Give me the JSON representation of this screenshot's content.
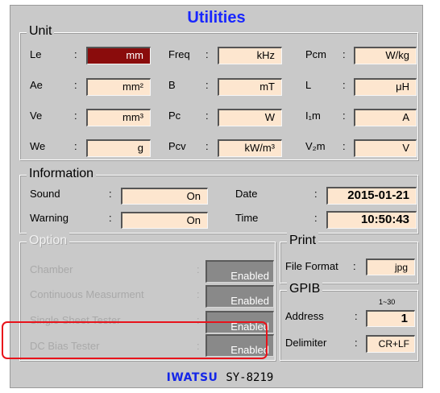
{
  "title": "Utilities",
  "unit": {
    "legend": "Unit",
    "fields": [
      {
        "label": "Le",
        "value": "mm",
        "selected": true
      },
      {
        "label": "Freq",
        "value": "kHz"
      },
      {
        "label": "Pcm",
        "value": "W/kg"
      },
      {
        "label": "Ae",
        "value": "mm²"
      },
      {
        "label": "B",
        "value": "mT"
      },
      {
        "label": "L",
        "value": "μH"
      },
      {
        "label": "Ve",
        "value": "mm³"
      },
      {
        "label": "Pc",
        "value": "W"
      },
      {
        "label": "I₁m",
        "value": "A"
      },
      {
        "label": "We",
        "value": "g"
      },
      {
        "label": "Pcv",
        "value": "kW/m³"
      },
      {
        "label": "V₂m",
        "value": "V"
      }
    ]
  },
  "information": {
    "legend": "Information",
    "sound": {
      "label": "Sound",
      "value": "On"
    },
    "warning": {
      "label": "Warning",
      "value": "On"
    },
    "date": {
      "label": "Date",
      "value": "2015-01-21"
    },
    "time": {
      "label": "Time",
      "value": "10:50:43"
    }
  },
  "option": {
    "legend": "Option",
    "items": [
      {
        "label": "Chamber",
        "value": "Enabled"
      },
      {
        "label": "Continuous Measurment",
        "value": "Enabled"
      },
      {
        "label": "Single Sheet Tester",
        "value": "Enabled"
      },
      {
        "label": "DC Bias Tester",
        "value": "Enabled"
      }
    ]
  },
  "print": {
    "legend": "Print",
    "file_format": {
      "label": "File Format",
      "value": "jpg"
    }
  },
  "gpib": {
    "legend": "GPIB",
    "range": "1~30",
    "address": {
      "label": "Address",
      "value": "1"
    },
    "delimiter": {
      "label": "Delimiter",
      "value": "CR+LF"
    }
  },
  "footer": {
    "brand": "IWATSU",
    "model": "SY-8219"
  },
  "colors": {
    "title": "#1826ff",
    "field": "#fde6cf",
    "selected": "#8a0c0c",
    "highlight": "#e8131b"
  },
  "colon": ":"
}
